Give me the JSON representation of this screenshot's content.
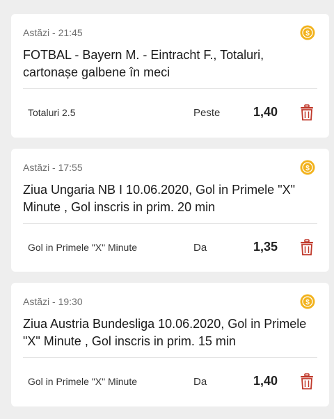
{
  "bets": [
    {
      "time": "Astăzi - 21:45",
      "title": "FOTBAL - Bayern M. - Eintracht F., Totaluri, cartonașe galbene în meci",
      "market": "Totaluri 2.5",
      "selection": "Peste",
      "odd": "1,40",
      "coin_icon": "dollar-coin-icon",
      "delete_icon": "trash-icon"
    },
    {
      "time": "Astăzi - 17:55",
      "title": "Ziua Ungaria NB I 10.06.2020, Gol in Primele \"X\" Minute , Gol inscris in prim. 20 min",
      "market": "Gol in Primele \"X\" Minute",
      "selection": "Da",
      "odd": "1,35",
      "coin_icon": "dollar-coin-icon",
      "delete_icon": "trash-icon"
    },
    {
      "time": "Astăzi - 19:30",
      "title": "Ziua Austria Bundesliga 10.06.2020, Gol in Primele \"X\" Minute , Gol inscris in prim. 15 min",
      "market": "Gol in Primele \"X\" Minute",
      "selection": "Da",
      "odd": "1,40",
      "coin_icon": "dollar-coin-icon",
      "delete_icon": "trash-icon"
    }
  ],
  "colors": {
    "coin": "#f2b21c",
    "trash": "#c0392b",
    "background": "#eeeeee"
  }
}
